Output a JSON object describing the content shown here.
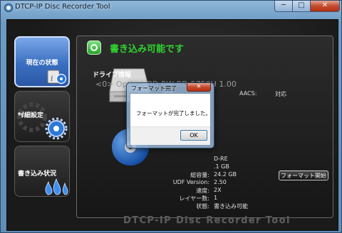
{
  "window": {
    "title": "DTCP-IP Disc Recorder Tool",
    "controls": {
      "minimize": "─",
      "maximize": "□",
      "close": "✕"
    }
  },
  "sidebar": {
    "items": [
      {
        "label": "現在の状態",
        "icon": "info-drive-icon",
        "active": true
      },
      {
        "label": "詳細設定",
        "icon": "gear-icon",
        "active": false
      },
      {
        "label": "書き込み状況",
        "icon": "flame-icon",
        "active": false
      }
    ]
  },
  "status": {
    "text": "書き込み可能です",
    "color": "#2fd62f",
    "icon": "check-ring-icon"
  },
  "drive": {
    "heading": "ドライブ情報",
    "name": "<0> Optiarc BD RW BD-5750H 1.00",
    "flags": [
      "対応",
      "AACS:",
      "対応"
    ]
  },
  "media": {
    "rows": [
      {
        "label": "",
        "value": "D-RE"
      },
      {
        "label": "",
        "value": ".1 GB"
      },
      {
        "label": "総容量:",
        "value": "24.2 GB"
      },
      {
        "label": "UDF Version:",
        "value": "2.50"
      },
      {
        "label": "速度:",
        "value": "2X"
      },
      {
        "label": "レイヤー数:",
        "value": "1"
      },
      {
        "label": "状態:",
        "value": "書き込み可能"
      }
    ],
    "format_button": "フォーマット開始"
  },
  "footer": {
    "logo": "DTCP-IP Disc Recorder Tool"
  },
  "dialog": {
    "title": "フォーマット完了",
    "close": "✕",
    "message": "フォーマットが完了しました。",
    "ok": "OK"
  }
}
